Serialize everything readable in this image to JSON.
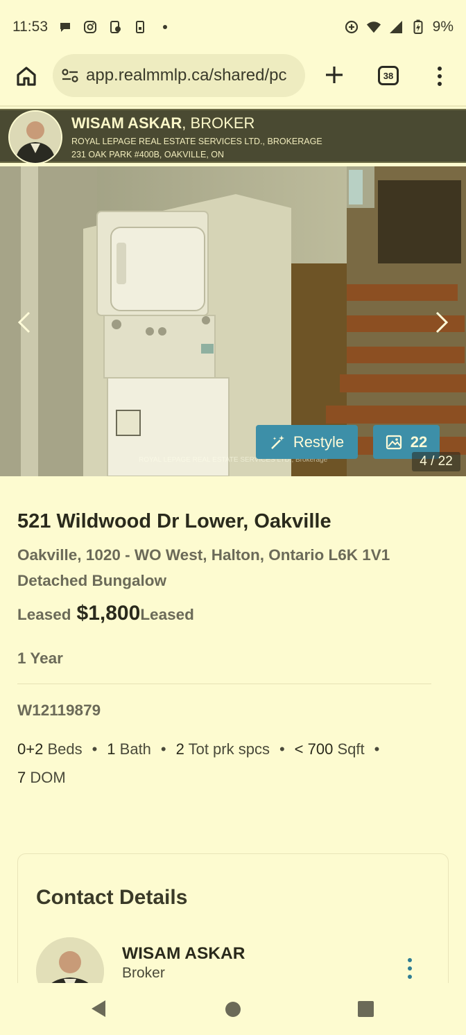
{
  "status_bar": {
    "time": "11:53",
    "battery": "9%",
    "left_icons": [
      "chat-bubble-icon",
      "instagram-icon",
      "phone-app-icon",
      "sim-card-icon",
      "dot-icon"
    ],
    "right_icons": [
      "data-saver-icon",
      "wifi-icon",
      "signal-icon",
      "battery-charging-icon"
    ]
  },
  "browser": {
    "url": "app.realmmlp.ca/shared/pc",
    "tab_count": "38"
  },
  "agent_banner": {
    "name": "WISAM ASKAR",
    "title": ", BROKER",
    "company": "ROYAL LEPAGE REAL ESTATE SERVICES LTD., BROKERAGE",
    "address": "231 OAK PARK #400B, OAKVILLE, ON"
  },
  "photo": {
    "restyle_label": "Restyle",
    "gallery_count": "22",
    "counter": "4 / 22",
    "watermark": "ROYAL LEPAGE REAL ESTATE SERVICES LTD., Brokerage"
  },
  "listing": {
    "address": "521 Wildwood Dr Lower, Oakville",
    "region": "Oakville, 1020 - WO West, Halton, Ontario L6K 1V1",
    "type": "Detached Bungalow",
    "status_prefix": "Leased",
    "price": "$1,800",
    "status_suffix": "Leased",
    "lease_term": "1 Year",
    "mls": "W12119879",
    "features": {
      "beds_num": "0+2",
      "beds_label": " Beds",
      "bath_num": "1",
      "bath_label": " Bath",
      "parking_num": "2",
      "parking_label": " Tot prk spcs",
      "sqft_num": "< 700",
      "sqft_label": " Sqft",
      "dom_num": "7",
      "dom_label": " DOM"
    }
  },
  "contact": {
    "title": "Contact Details",
    "name": "WISAM ASKAR",
    "role": "Broker"
  },
  "colors": {
    "background": "#fdfbd0",
    "banner": "#4a4a32",
    "accent": "#3d8fa8"
  }
}
